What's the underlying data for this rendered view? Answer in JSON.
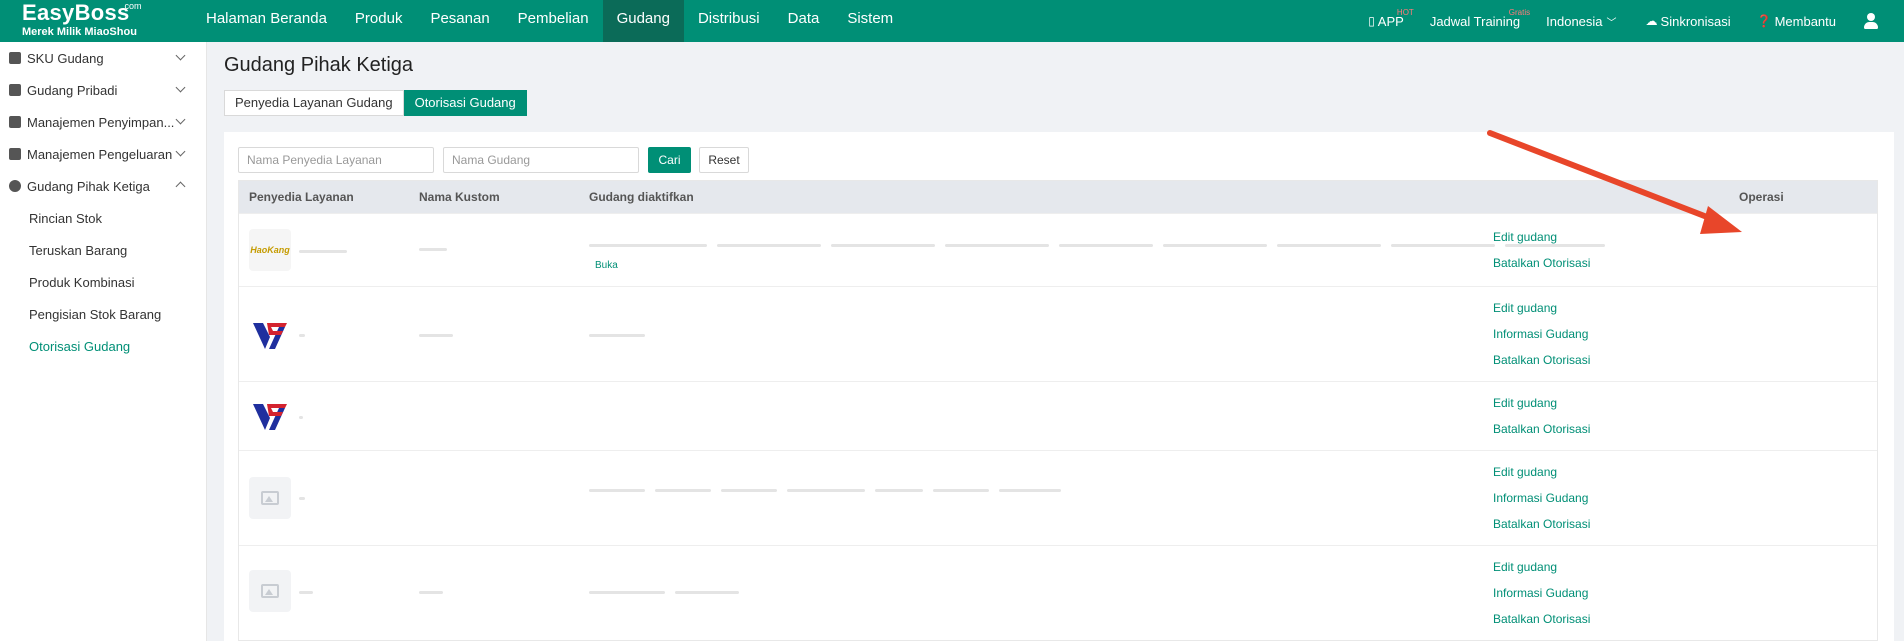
{
  "header": {
    "brand": "EasyBoss",
    "brand_suffix": ".com",
    "tagline": "Merek Milik MiaoShou",
    "nav": [
      {
        "label": "Halaman Beranda"
      },
      {
        "label": "Produk"
      },
      {
        "label": "Pesanan"
      },
      {
        "label": "Pembelian"
      },
      {
        "label": "Gudang"
      },
      {
        "label": "Distribusi"
      },
      {
        "label": "Data"
      },
      {
        "label": "Sistem"
      }
    ],
    "active_nav": "Gudang",
    "app_label": "APP",
    "app_badge": "HOT",
    "training_label": "Jadwal Training",
    "training_badge": "Gratis",
    "language": "Indonesia",
    "sync_label": "Sinkronisasi",
    "help_label": "Membantu",
    "color_primary": "#008f76"
  },
  "sidebar": {
    "groups": [
      {
        "label": "SKU Gudang",
        "icon": "sku-icon"
      },
      {
        "label": "Gudang Pribadi",
        "icon": "warehouse-icon"
      },
      {
        "label": "Manajemen Penyimpan...",
        "icon": "inbound-icon"
      },
      {
        "label": "Manajemen Pengeluaran",
        "icon": "outbound-icon"
      },
      {
        "label": "Gudang Pihak Ketiga",
        "icon": "third-party-icon"
      }
    ],
    "sub_items": [
      {
        "label": "Rincian Stok"
      },
      {
        "label": "Teruskan Barang"
      },
      {
        "label": "Produk Kombinasi"
      },
      {
        "label": "Pengisian Stok Barang"
      },
      {
        "label": "Otorisasi Gudang"
      }
    ],
    "active_item": "Otorisasi Gudang"
  },
  "main": {
    "title": "Gudang Pihak Ketiga",
    "tabs": [
      {
        "label": "Penyedia Layanan Gudang"
      },
      {
        "label": "Otorisasi Gudang"
      }
    ],
    "active_tab": "Otorisasi Gudang",
    "filters": {
      "provider_placeholder": "Nama Penyedia Layanan",
      "warehouse_placeholder": "Nama Gudang",
      "search_label": "Cari",
      "reset_label": "Reset"
    },
    "table": {
      "columns": [
        "Penyedia Layanan",
        "Nama Kustom",
        "Gudang diaktifkan",
        "Operasi"
      ],
      "rows": [
        {
          "logo": "hk-logo",
          "logo_text": "HaoKang",
          "extra_link": "Buka",
          "operations": [
            "Edit gudang",
            "Batalkan Otorisasi"
          ]
        },
        {
          "logo": "yf-logo",
          "operations": [
            "Edit gudang",
            "Informasi Gudang",
            "Batalkan Otorisasi"
          ]
        },
        {
          "logo": "yf-logo",
          "operations": [
            "Edit gudang",
            "Batalkan Otorisasi"
          ]
        },
        {
          "logo": "image-placeholder-icon",
          "operations": [
            "Edit gudang",
            "Informasi Gudang",
            "Batalkan Otorisasi"
          ]
        },
        {
          "logo": "image-placeholder-icon",
          "operations": [
            "Edit gudang",
            "Informasi Gudang",
            "Batalkan Otorisasi"
          ]
        }
      ]
    }
  },
  "annotation": {
    "arrow_color": "#e8462a"
  }
}
